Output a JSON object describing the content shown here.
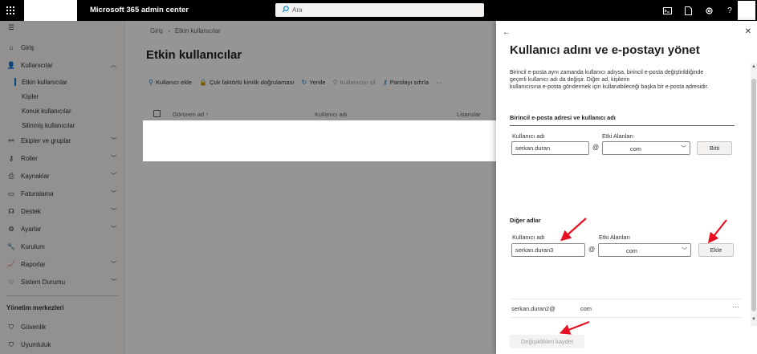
{
  "topbar": {
    "app_title": "Microsoft 365 admin center",
    "search_placeholder": "Ara"
  },
  "nav": {
    "items": [
      {
        "label": "Giriş",
        "icon": "home-icon"
      },
      {
        "label": "Kullanıcılar",
        "icon": "person-icon",
        "expanded": true
      },
      {
        "label": "Ekipler ve gruplar",
        "icon": "group-icon"
      },
      {
        "label": "Roller",
        "icon": "key-icon"
      },
      {
        "label": "Kaynaklar",
        "icon": "printer-icon"
      },
      {
        "label": "Faturalama",
        "icon": "card-icon"
      },
      {
        "label": "Destek",
        "icon": "headset-icon"
      },
      {
        "label": "Ayarlar",
        "icon": "gear-icon"
      },
      {
        "label": "Kurulum",
        "icon": "wrench-icon"
      },
      {
        "label": "Raporlar",
        "icon": "chart-icon"
      },
      {
        "label": "Sistem Durumu",
        "icon": "heart-icon"
      }
    ],
    "sub_items": [
      "Etkin kullanıcılar",
      "Kişiler",
      "Konuk kullanıcılar",
      "Silinmiş kullanıcılar"
    ],
    "admin_centers_header": "Yönetim merkezleri",
    "admin_centers": [
      {
        "label": "Güvenlik",
        "icon": "shield-icon"
      },
      {
        "label": "Uyumluluk",
        "icon": "shield-icon"
      }
    ]
  },
  "main": {
    "breadcrumb": {
      "home": "Giriş",
      "separator": "›",
      "current": "Etkin kullanıcılar"
    },
    "title": "Etkin kullanıcılar",
    "commands": [
      {
        "label": "Kullanıcı ekle",
        "icon": "add-person-icon",
        "disabled": false
      },
      {
        "label": "Çok faktörlü kimlik doğrulaması",
        "icon": "lock-icon",
        "disabled": false
      },
      {
        "label": "Yenile",
        "icon": "refresh-icon",
        "disabled": false
      },
      {
        "label": "Kullanıcıyı sil",
        "icon": "delete-person-icon",
        "disabled": true
      },
      {
        "label": "Parolayı sıfırla",
        "icon": "key-icon",
        "disabled": false
      }
    ],
    "more": "···",
    "columns": {
      "display_name": "Görünen ad ↑",
      "username": "Kullanıcı adı",
      "licenses": "Lisanslar"
    }
  },
  "panel": {
    "title": "Kullanıcı adını ve e-postayı yönet",
    "description": [
      "Birincil e-posta aynı zamanda kullanıcı adıysa, birincil e-posta değiştirildiğinde",
      "geçerli kullanıcı adı da değişir. Diğer ad, kişilerin",
      "kullanıcısına e-posta göndermek için kullanabileceği başka bir e-posta adresidir."
    ],
    "primary_section": "Birincil e-posta adresi ve kullanıcı adı",
    "username_label": "Kullanıcı adı",
    "domains_label": "Etki Alanları",
    "primary_username": "serkan.duran",
    "at": "@",
    "primary_domain": "com",
    "done_button": "Bitti",
    "aliases_section": "Diğer adlar",
    "alias_username_label": "Kullanıcı adı",
    "alias_domains_label": "Etki Alanları",
    "alias_username": "serkan.duran3",
    "alias_domain": "com",
    "add_button": "Ekle",
    "alias_list": [
      {
        "name": "serkan.duran2@",
        "domain": "com"
      }
    ],
    "alias_more": "···",
    "save_button": "Değişiklikleri kaydet"
  },
  "colors": {
    "accent": "#0078d4",
    "annotation_arrow": "#e81123"
  }
}
